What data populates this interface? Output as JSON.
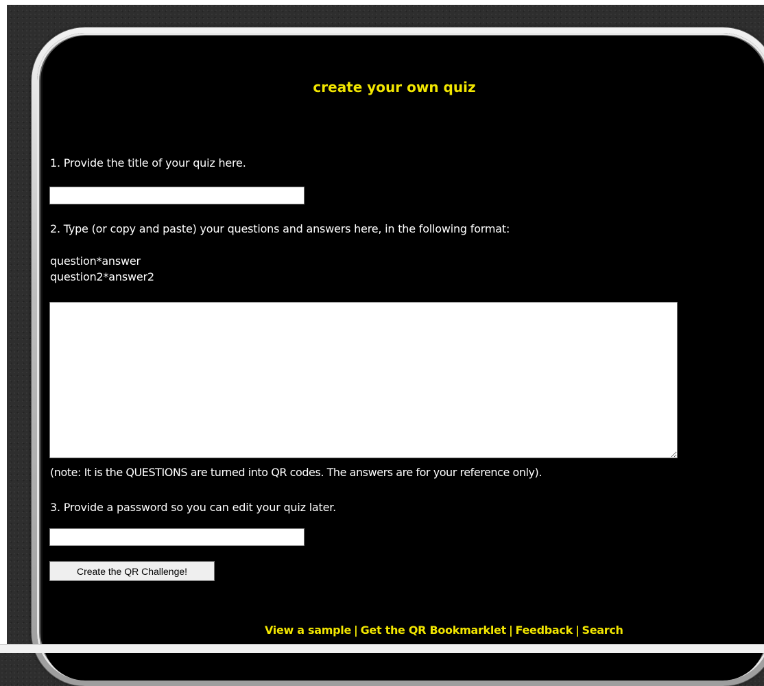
{
  "page": {
    "title": "create your own quiz"
  },
  "form": {
    "step1_label": "1. Provide the title of your quiz here.",
    "title_value": "",
    "step2_label": "2. Type (or copy and paste) your questions and answers here, in the following format:",
    "format_example_line1": "question*answer",
    "format_example_line2": "question2*answer2",
    "questions_value": "",
    "note": "(note: It is the QUESTIONS are turned into QR codes. The answers are for your reference only).",
    "step3_label": "3. Provide a password so you can edit your quiz later.",
    "password_value": "",
    "submit_label": "Create the QR Challenge!"
  },
  "footer": {
    "links": [
      {
        "label": "View a sample"
      },
      {
        "label": "Get the QR Bookmarklet"
      },
      {
        "label": "Feedback"
      },
      {
        "label": "Search"
      }
    ],
    "separator": "|"
  },
  "colors": {
    "accent": "#f2e600",
    "screen_background": "#000000",
    "text": "#ffffff"
  }
}
